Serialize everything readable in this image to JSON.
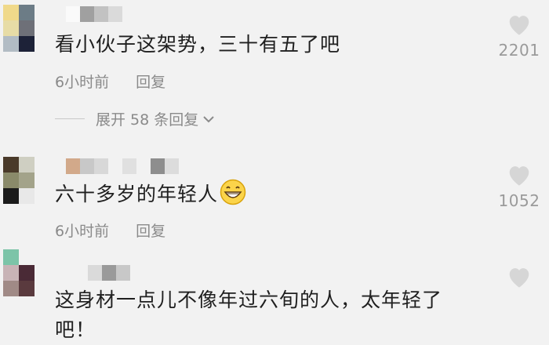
{
  "comments": [
    {
      "text": "看小伙子这架势，三十有五了吧",
      "time": "6小时前",
      "reply": "回复",
      "likes": "2201"
    },
    {
      "text": "六十多岁的年轻人",
      "emoji": "grinning-face-emoji",
      "time": "6小时前",
      "reply": "回复",
      "likes": "1052"
    },
    {
      "text_line1": "这身材一点儿不像年过六旬的人，太年轻了",
      "text_line2": "吧！"
    }
  ],
  "expand": {
    "label": "展开 58 条回复"
  },
  "colors": {
    "background": "#f2f2f2",
    "meta_text": "#8a8a8a",
    "like_icon": "#d6d6d6"
  }
}
